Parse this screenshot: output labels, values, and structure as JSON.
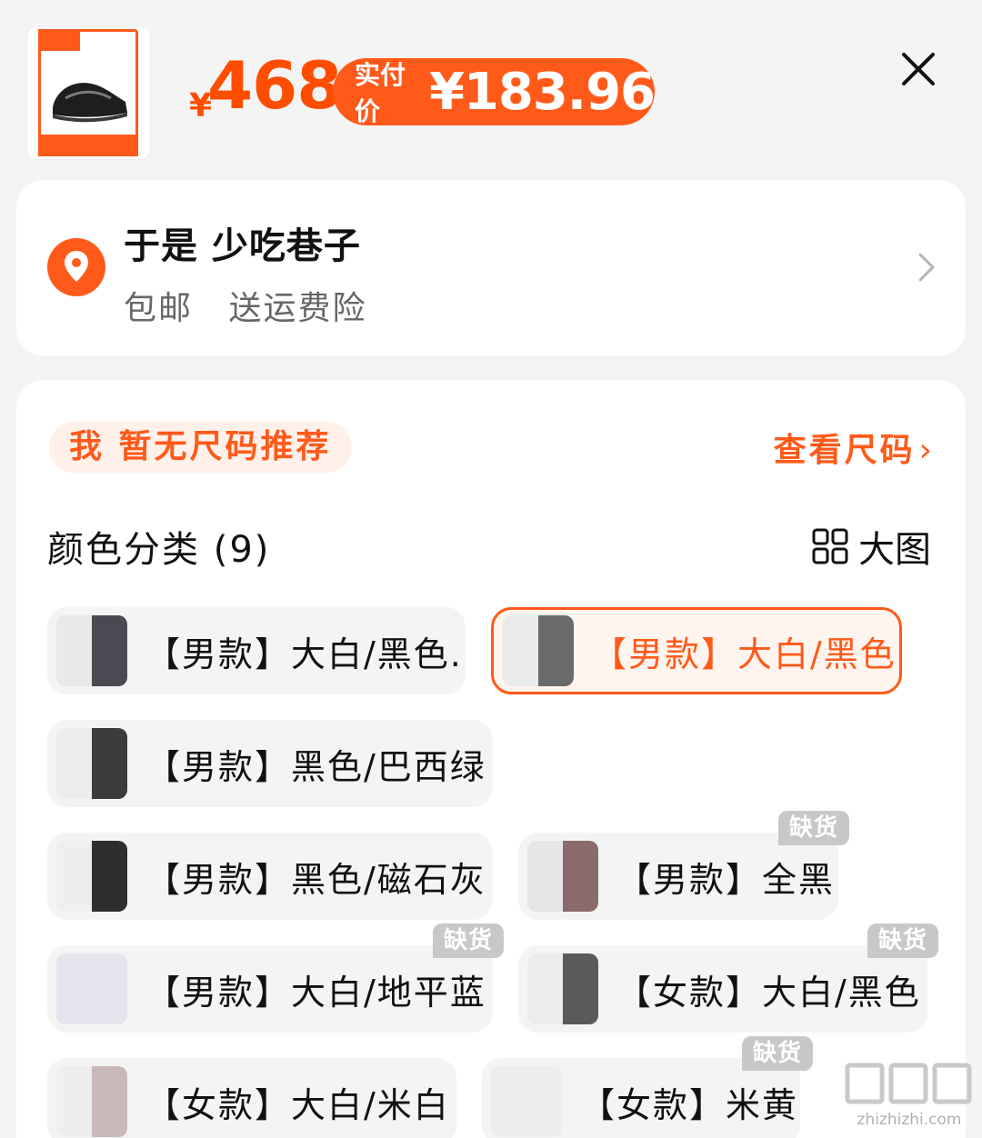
{
  "header": {
    "currency": "¥",
    "price": "468",
    "paid_label": "实付价",
    "paid_value": "¥183.96"
  },
  "address": {
    "name": "于是 少吃巷子",
    "tags": [
      "包邮",
      "送运费险"
    ]
  },
  "size": {
    "recommend": "我 暂无尺码推荐",
    "link": "查看尺码"
  },
  "colors": {
    "title": "颜色分类 (9)",
    "view_label": "大图",
    "out_of_stock": "缺货",
    "options": [
      {
        "label": "【男款】大白/黑色.",
        "selected": false,
        "out_of_stock": false
      },
      {
        "label": "【男款】大白/黑色",
        "selected": true,
        "out_of_stock": false
      },
      {
        "label": "【男款】黑色/巴西绿",
        "selected": false,
        "out_of_stock": false
      },
      {
        "label": "【男款】黑色/磁石灰",
        "selected": false,
        "out_of_stock": false
      },
      {
        "label": "【男款】全黑",
        "selected": false,
        "out_of_stock": true
      },
      {
        "label": "【男款】大白/地平蓝",
        "selected": false,
        "out_of_stock": true
      },
      {
        "label": "【女款】大白/黑色",
        "selected": false,
        "out_of_stock": true
      },
      {
        "label": "【女款】大白/米白",
        "selected": false,
        "out_of_stock": false
      },
      {
        "label": "【女款】米黄",
        "selected": false,
        "out_of_stock": true
      }
    ]
  },
  "watermark": {
    "text": "zhizhizhi.com"
  },
  "colors_theme": {
    "accent": "#ff5a1a",
    "badge": "#c8c8c8"
  }
}
